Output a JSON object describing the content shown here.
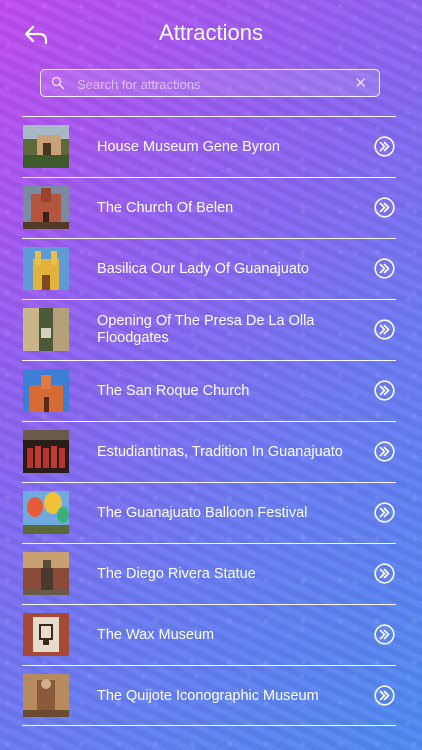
{
  "header": {
    "title": "Attractions"
  },
  "search": {
    "placeholder": "Search for attractions"
  },
  "icons": {
    "back": "back-arrow-icon",
    "search": "search-icon",
    "clear": "close-icon",
    "row_action": "double-chevron-right-icon"
  },
  "items": [
    {
      "label": "House Museum Gene Byron"
    },
    {
      "label": "The Church Of Belen"
    },
    {
      "label": "Basilica Our Lady Of Guanajuato"
    },
    {
      "label": "Opening Of The Presa De La Olla Floodgates"
    },
    {
      "label": "The San Roque Church"
    },
    {
      "label": "Estudiantinas, Tradition In Guanajuato"
    },
    {
      "label": "The Guanajuato Balloon Festival"
    },
    {
      "label": "The Diego Rivera Statue"
    },
    {
      "label": "The Wax Museum"
    },
    {
      "label": "The Quijote Iconographic Museum"
    }
  ],
  "colors": {
    "gradient_start": "#c14cf0",
    "gradient_end": "#4f8bf2",
    "text": "#ffffff"
  }
}
